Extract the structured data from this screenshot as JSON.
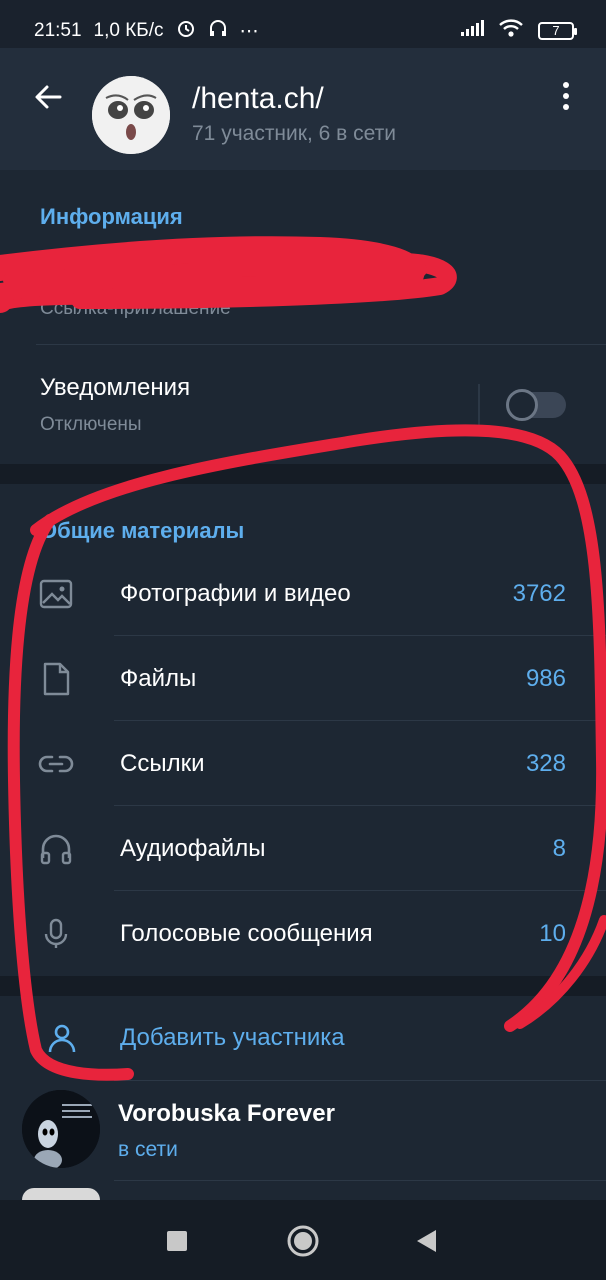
{
  "status_bar": {
    "time": "21:51",
    "speed": "1,0 КБ/с",
    "extra": "⋯",
    "battery": "7"
  },
  "header": {
    "title": "/henta.ch/",
    "subtitle": "71 участник, 6 в сети"
  },
  "info": {
    "section_title": "Информация",
    "invite_link_label": "Ссылка-приглашение",
    "notifications_label": "Уведомления",
    "notifications_value": "Отключены",
    "notifications_enabled": false
  },
  "media": {
    "section_title": "Общие материалы",
    "items": [
      {
        "icon": "photo-icon",
        "label": "Фотографии и видео",
        "count": "3762"
      },
      {
        "icon": "file-icon",
        "label": "Файлы",
        "count": "986"
      },
      {
        "icon": "link-icon",
        "label": "Ссылки",
        "count": "328"
      },
      {
        "icon": "headphones-icon",
        "label": "Аудиофайлы",
        "count": "8"
      },
      {
        "icon": "microphone-icon",
        "label": "Голосовые сообщения",
        "count": "10"
      }
    ]
  },
  "members": {
    "add_label": "Добавить участника",
    "list": [
      {
        "name": "Vorobuska Forever",
        "status": "в сети"
      }
    ]
  },
  "colors": {
    "accent": "#5eaeed",
    "background": "#1d2733",
    "header": "#232e3c",
    "scribble": "#e8243c"
  }
}
